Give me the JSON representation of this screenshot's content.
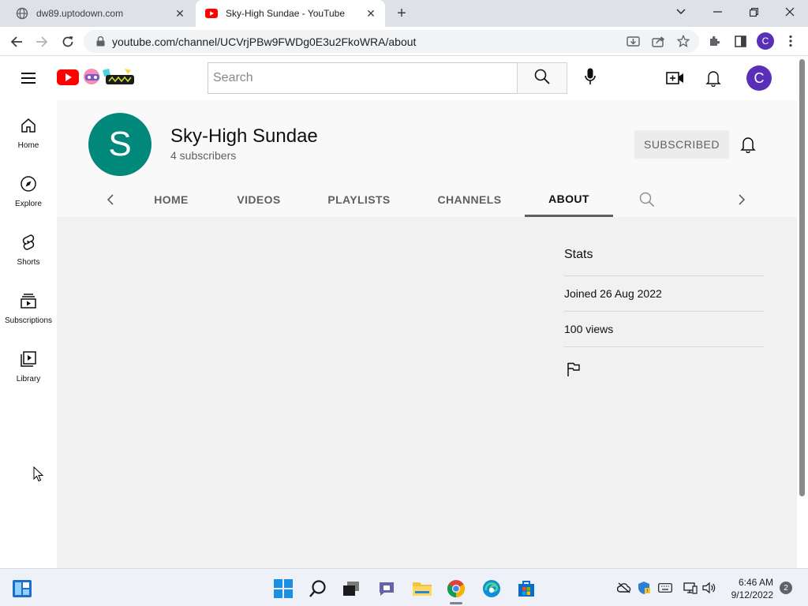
{
  "browser": {
    "tabs": [
      {
        "title": "dw89.uptodown.com",
        "close": "✕"
      },
      {
        "title": "Sky-High Sundae - YouTube",
        "close": "✕"
      }
    ],
    "new_tab": "+",
    "url": "youtube.com/channel/UCVrjPBw9FWDg0E3u2FkoWRA/about",
    "profile_initial": "C"
  },
  "masthead": {
    "search_placeholder": "Search",
    "avatar_initial": "C"
  },
  "guide": {
    "items": [
      {
        "label": "Home",
        "icon": "home-icon"
      },
      {
        "label": "Explore",
        "icon": "compass-icon"
      },
      {
        "label": "Shorts",
        "icon": "shorts-icon"
      },
      {
        "label": "Subscriptions",
        "icon": "subscriptions-icon"
      },
      {
        "label": "Library",
        "icon": "library-icon"
      }
    ]
  },
  "channel": {
    "avatar_letter": "S",
    "name": "Sky-High Sundae",
    "subscribers": "4 subscribers",
    "subscribe_label": "SUBSCRIBED",
    "tabs": [
      "HOME",
      "VIDEOS",
      "PLAYLISTS",
      "CHANNELS",
      "ABOUT"
    ],
    "active_tab": "ABOUT",
    "avatar_color": "#00897b"
  },
  "stats": {
    "title": "Stats",
    "joined": "Joined 26 Aug 2022",
    "views": "100 views"
  },
  "taskbar": {
    "time": "6:46 AM",
    "date": "9/12/2022",
    "notifications": "2"
  },
  "colors": {
    "youtube_red": "#ff0000",
    "avatar_purple": "#5a2fb8"
  }
}
